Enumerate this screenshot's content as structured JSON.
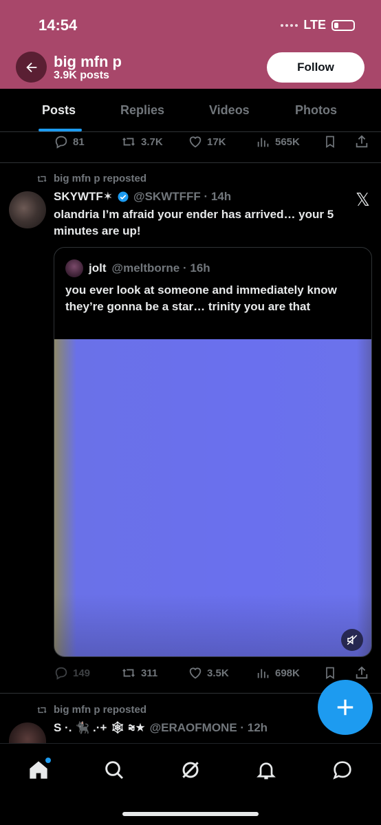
{
  "status_bar": {
    "time": "14:54",
    "network": "LTE"
  },
  "header": {
    "name": "big mfn p",
    "posts": "3.9K posts",
    "follow_label": "Follow",
    "bg_color": "#a8476a"
  },
  "tabs": [
    {
      "label": "Posts",
      "active": true
    },
    {
      "label": "Replies",
      "active": false
    },
    {
      "label": "Videos",
      "active": false
    },
    {
      "label": "Photos",
      "active": false
    }
  ],
  "post_top": {
    "replies": "81",
    "reposts": "3.7K",
    "likes": "17K",
    "views": "565K"
  },
  "post_main": {
    "repost_label": "big mfn p reposted",
    "author_name": "SKYWTF✶",
    "author_handle": "@SKWTFFF · 14h",
    "text": "olandria I’m afraid your ender has arrived… your 5 minutes are up!",
    "quote": {
      "name": "jolt",
      "handle": "@meltborne · 16h",
      "text": "you ever look at someone and immediately know they’re gonna be a star… trinity you are that"
    },
    "replies": "149",
    "reposts": "311",
    "likes": "3.5K",
    "views": "698K"
  },
  "post_next": {
    "repost_label": "big mfn p reposted",
    "author_name": "S ·. 🐈‍⬛ .·+ 🕸 ⩬★",
    "author_handle": "@ERAOFMONE · 12h"
  },
  "accent_color": "#1d9bf0"
}
